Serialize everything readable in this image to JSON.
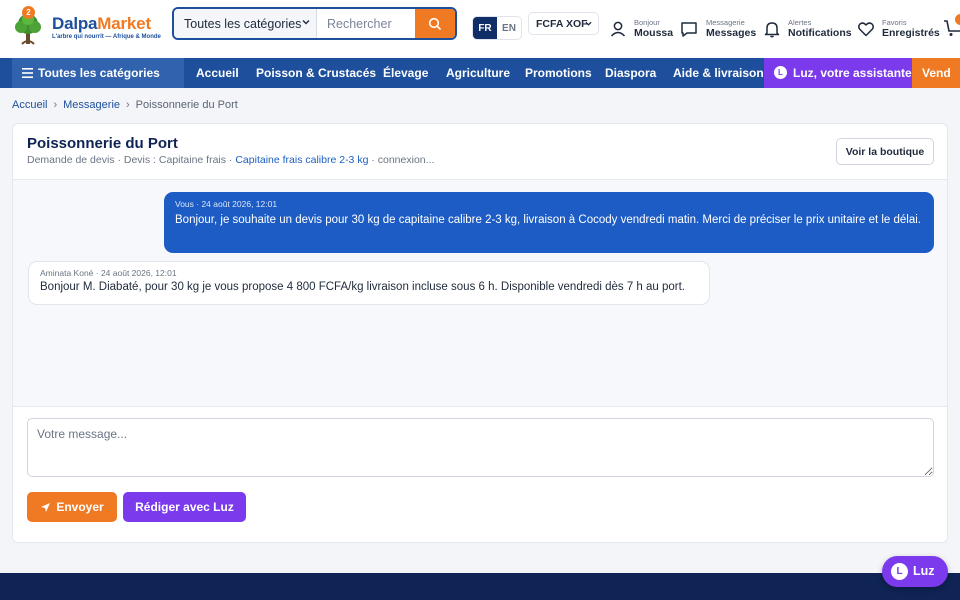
{
  "header": {
    "logo": {
      "part1": "Dalpa",
      "part2": "Market",
      "tagline": "L'arbre qui nourrit — Afrique & Monde",
      "badge": "2"
    },
    "search": {
      "category": "Toutes les catégories",
      "placeholder": "Rechercher"
    },
    "lang": {
      "active": "FR",
      "other": "EN"
    },
    "currency": "FCFA XOF",
    "account": {
      "small": "Bonjour",
      "big": "Moussa"
    },
    "messages": {
      "small": "Messagerie",
      "big": "Messages"
    },
    "alerts": {
      "small": "Alertes",
      "big": "Notifications"
    },
    "favorites": {
      "small": "Favoris",
      "big": "Enregistrés"
    }
  },
  "nav": {
    "all_categories": "Toutes les catégories",
    "links": [
      "Accueil",
      "Poisson & Crustacés",
      "Élevage",
      "Agriculture",
      "Promotions",
      "Diaspora",
      "Aide & livraison"
    ],
    "luz": "Luz, votre assistante",
    "luz_initial": "L",
    "vendre": "Vend"
  },
  "breadcrumb": {
    "home": "Accueil",
    "section": "Messagerie",
    "current": "Poissonnerie du Port"
  },
  "conversation": {
    "title": "Poissonnerie du Port",
    "subtitle_prefix": "Demande de devis · Devis : Capitaine frais · ",
    "subtitle_link": "Capitaine frais calibre 2-3 kg",
    "subtitle_suffix": " · connexion...",
    "shop_button": "Voir la boutique",
    "messages": [
      {
        "meta": "Vous · 24 août 2026, 12:01",
        "text": "Bonjour, je souhaite un devis pour 30 kg de capitaine calibre 2-3 kg, livraison à Cocody vendredi matin. Merci de préciser le prix unitaire et le délai."
      },
      {
        "meta": "Aminata Koné · 24 août 2026, 12:01",
        "text": "Bonjour M. Diabaté, pour 30 kg je vous propose 4 800 FCFA/kg livraison incluse sous 6 h. Disponible vendredi dès 7 h au port."
      }
    ],
    "input_placeholder": "Votre message...",
    "send_label": "Envoyer",
    "luz_label": "Rédiger avec Luz"
  },
  "floating": {
    "label": "Luz",
    "initial": "L"
  },
  "colors": {
    "brand_blue": "#1d4f9c",
    "brand_orange": "#f07a23",
    "luz_purple": "#7c3aed",
    "footer": "#0f2454"
  }
}
